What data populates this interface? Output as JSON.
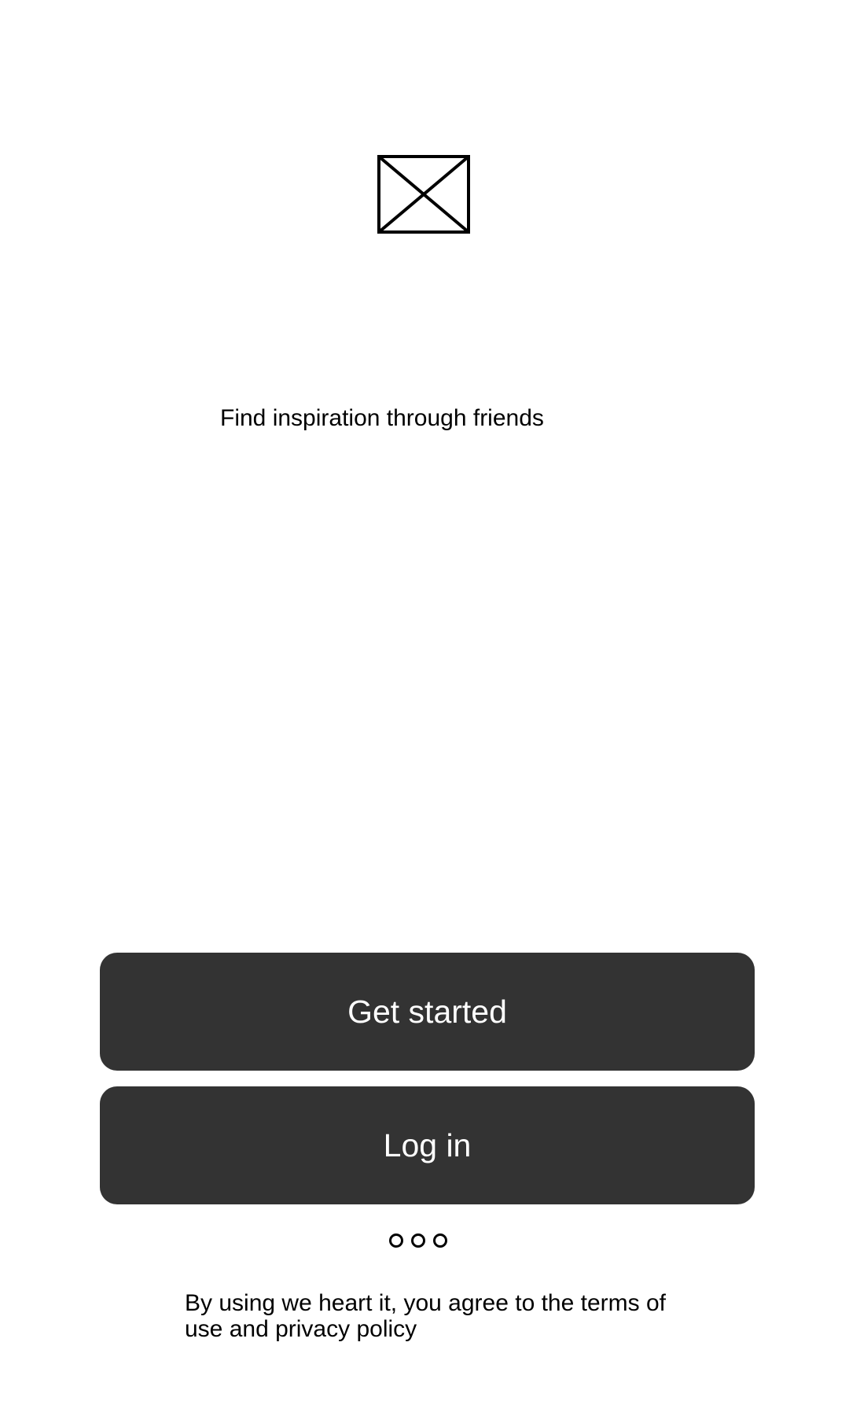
{
  "logo": {
    "icon": "image-placeholder-icon"
  },
  "tagline": "Find inspiration through friends",
  "actions": {
    "get_started_label": "Get started",
    "login_label": "Log in"
  },
  "pager": {
    "page_count": 3
  },
  "legal": {
    "text": "By using we heart it, you agree to the terms of use and privacy policy"
  },
  "colors": {
    "button_background": "#333333",
    "button_text": "#ffffff",
    "page_background": "#ffffff"
  }
}
